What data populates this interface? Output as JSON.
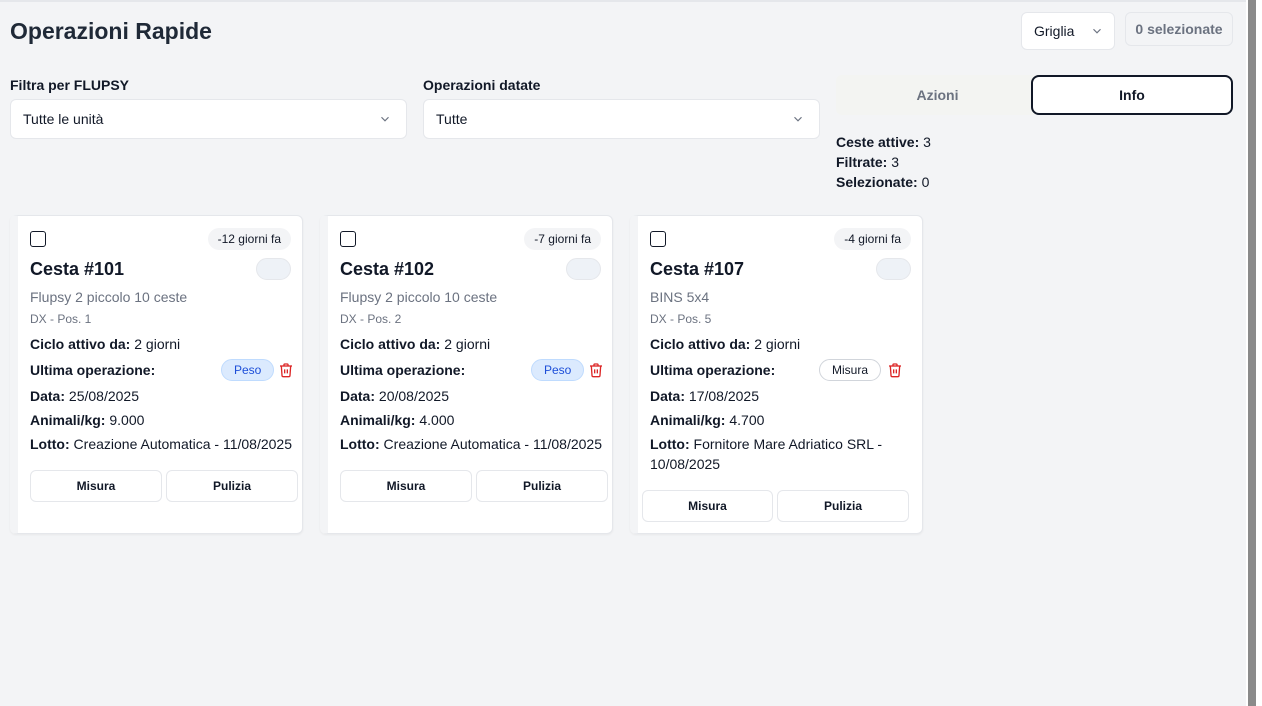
{
  "header": {
    "title": "Operazioni Rapide",
    "view_select": "Griglia",
    "selected_count": "0 selezionate"
  },
  "filters": {
    "flupsy_label": "Filtra per FLUPSY",
    "flupsy_value": "Tutte le unità",
    "dated_label": "Operazioni datate",
    "dated_value": "Tutte"
  },
  "tabs": {
    "azioni": "Azioni",
    "info": "Info"
  },
  "stats": {
    "attive_label": "Ceste attive:",
    "attive": "3",
    "filtrate_label": "Filtrate:",
    "filtrate": "3",
    "selezionate_label": "Selezionate:",
    "selezionate": "0"
  },
  "labels": {
    "ciclo": "Ciclo attivo da:",
    "ultima": "Ultima operazione:",
    "data": "Data:",
    "animali": "Animali/kg:",
    "lotto": "Lotto:",
    "misura_btn": "Misura",
    "pulizia_btn": "Pulizia"
  },
  "cards": [
    {
      "ago": "-12 giorni fa",
      "title": "Cesta #101",
      "flupsy": "Flupsy 2 piccolo 10 ceste",
      "position": "DX - Pos. 1",
      "ciclo": "2 giorni",
      "operation": "Peso",
      "data": "25/08/2025",
      "animali": "9.000",
      "lotto": "Creazione Automatica - 11/08/2025"
    },
    {
      "ago": "-7 giorni fa",
      "title": "Cesta #102",
      "flupsy": "Flupsy 2 piccolo 10 ceste",
      "position": "DX - Pos. 2",
      "ciclo": "2 giorni",
      "operation": "Peso",
      "data": "20/08/2025",
      "animali": "4.000",
      "lotto": "Creazione Automatica - 11/08/2025"
    },
    {
      "ago": "-4 giorni fa",
      "title": "Cesta #107",
      "flupsy": "BINS 5x4",
      "position": "DX - Pos. 5",
      "ciclo": "2 giorni",
      "operation": "Misura",
      "data": "17/08/2025",
      "animali": "4.700",
      "lotto": "Fornitore Mare Adriatico SRL - 10/08/2025"
    }
  ],
  "colors": {
    "background": "#f3f4f6",
    "peso_badge": "#dbeafe",
    "trash": "#dc2626"
  },
  "icons": [
    "chevron-down-icon",
    "trash-icon",
    "checkbox-icon"
  ]
}
